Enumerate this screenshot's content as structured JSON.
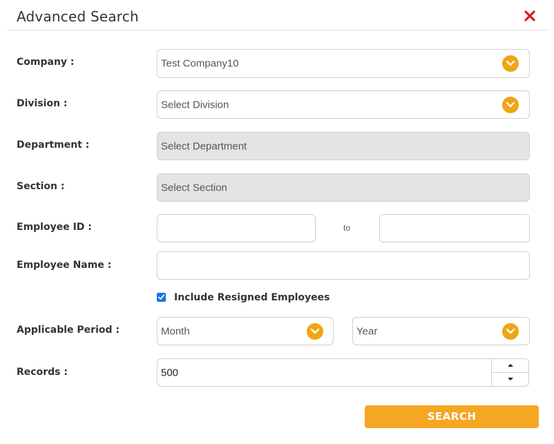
{
  "dialog": {
    "title": "Advanced Search",
    "close_icon": "close-x-icon"
  },
  "form": {
    "company": {
      "label": "Company :",
      "value": "Test Company10"
    },
    "division": {
      "label": "Division :",
      "placeholder": "Select Division"
    },
    "department": {
      "label": "Department :",
      "placeholder": "Select Department",
      "disabled": true
    },
    "section": {
      "label": "Section :",
      "placeholder": "Select Section",
      "disabled": true
    },
    "employee_id": {
      "label": "Employee ID :",
      "from": "",
      "to": "",
      "separator": "to"
    },
    "employee_name": {
      "label": "Employee Name :",
      "value": ""
    },
    "include_resigned": {
      "label": "Include Resigned Employees",
      "checked": true
    },
    "applicable_period": {
      "label": "Applicable Period :",
      "month_placeholder": "Month",
      "year_placeholder": "Year"
    },
    "records": {
      "label": "Records :",
      "value": "500"
    }
  },
  "actions": {
    "search_label": "SEARCH"
  },
  "colors": {
    "accent": "#f5a623",
    "chevron": "#f0a515",
    "close": "#e0141e",
    "checkbox": "#1a73e8",
    "disabled_bg": "#e6e3e3"
  }
}
